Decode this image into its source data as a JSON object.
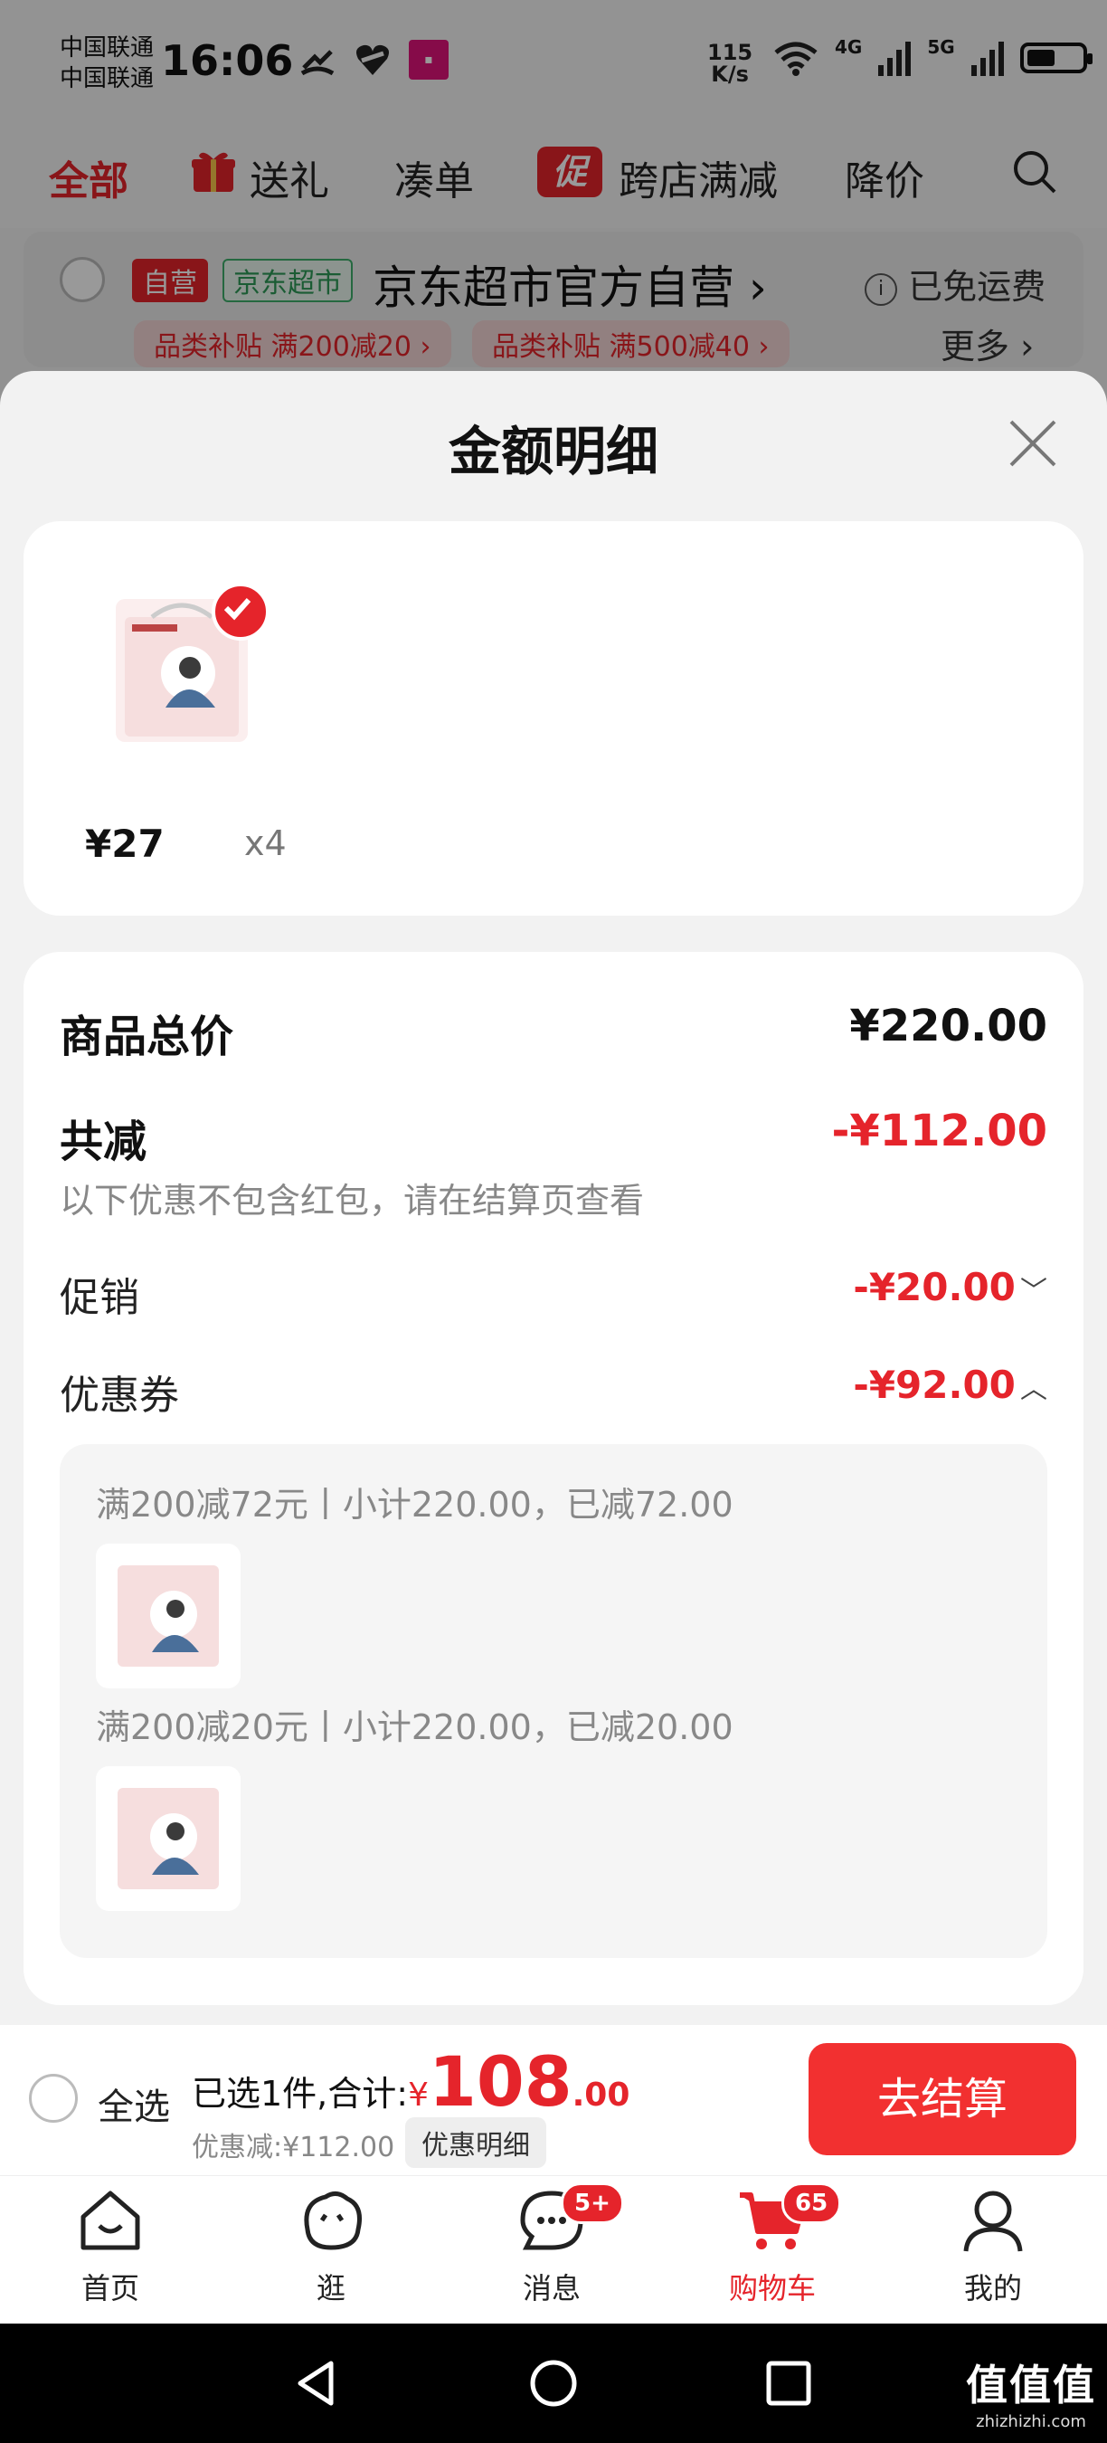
{
  "status_bar": {
    "carrier_1": "中国联通",
    "carrier_2": "中国联通",
    "time": "16:06",
    "speed_value": "115",
    "speed_unit": "K/s",
    "network_1": "4G",
    "network_2": "5G",
    "battery_level": 0.45
  },
  "tabs": [
    {
      "label": "全部"
    },
    {
      "label": "送礼"
    },
    {
      "label": "凑单"
    },
    {
      "label": "跨店满减",
      "badge": "促"
    },
    {
      "label": "降价"
    }
  ],
  "store": {
    "tag_self": "自营",
    "tag_supermarket": "京东超市",
    "name": "京东超市官方自营",
    "free_shipping": "已免运费",
    "chip_1": "品类补贴 满200减20",
    "chip_2": "品类补贴 满500减40",
    "more": "更多"
  },
  "sheet": {
    "title": "金额明细",
    "item": {
      "price": "¥27",
      "qty": "x4"
    },
    "total_label": "商品总价",
    "total_value": "¥220.00",
    "reduce_label": "共减",
    "reduce_value": "-¥112.00",
    "reduce_note": "以下优惠不包含红包，请在结算页查看",
    "promo_label": "促销",
    "promo_value": "-¥20.00",
    "coupon_label": "优惠券",
    "coupon_value": "-¥92.00",
    "coupons": [
      {
        "text": "满200减72元丨小计220.00，已减72.00"
      },
      {
        "text": "满200减20元丨小计220.00，已减20.00"
      }
    ]
  },
  "checkout": {
    "select_all": "全选",
    "summary_prefix": "已选1件,合计:",
    "currency": "¥",
    "total_int": "108",
    "total_dec": ".00",
    "discount": "优惠减:¥112.00",
    "detail_button": "优惠明细",
    "checkout_button": "去结算"
  },
  "nav": [
    {
      "label": "首页",
      "icon": "home-icon"
    },
    {
      "label": "逛",
      "icon": "browse-icon"
    },
    {
      "label": "消息",
      "icon": "message-icon",
      "badge": "5+"
    },
    {
      "label": "购物车",
      "icon": "cart-icon",
      "badge": "65"
    },
    {
      "label": "我的",
      "icon": "profile-icon"
    }
  ],
  "watermark": {
    "main": "值值值",
    "sub": "zhizhizhi.com"
  },
  "colors": {
    "accent": "#e5242b",
    "checkout": "#f23030"
  }
}
